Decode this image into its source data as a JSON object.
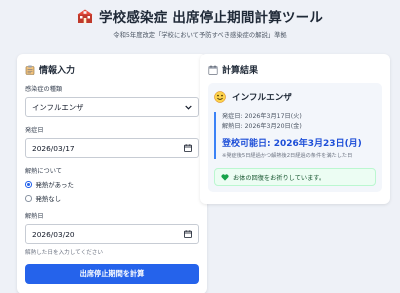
{
  "header": {
    "icon": "school-icon",
    "title": "学校感染症 出席停止期間計算ツール",
    "subtitle": "令和5年度改定「学校において予防すべき感染症の解説」準拠"
  },
  "form": {
    "section_icon": "clipboard-icon",
    "section_title": "情報入力",
    "disease_label": "感染症の種類",
    "disease_value": "インフルエンザ",
    "onset_label": "発症日",
    "onset_value": "2026/03/17",
    "fever_label": "解熱について",
    "fever_options": [
      "発熱があった",
      "発熱なし"
    ],
    "fever_selected": "発熱があった",
    "defervescence_label": "解熱日",
    "defervescence_value": "2026/03/20",
    "defervescence_hint": "解熱した日を入力してください",
    "submit_label": "出席停止期間を計算"
  },
  "result": {
    "section_icon": "calendar-icon",
    "section_title": "計算結果",
    "disease_icon": "smiley-icon",
    "disease_name": "インフルエンザ",
    "onset_text": "発症日: 2026年3月17日(火)",
    "defervescence_text": "解熱日: 2026年3月20日(金)",
    "return_text": "登校可能日: 2026年3月23日(月)",
    "note": "※発症後5日経過かつ解熱後2日経過の条件を満たした日",
    "message_icon": "green-heart-icon",
    "message": "お体の回復をお祈りしています。"
  },
  "colors": {
    "accent": "#2563eb",
    "return_date": "#1d4ed8",
    "message_bg": "#ecfdf3",
    "page_bg": "#eef1f7"
  }
}
